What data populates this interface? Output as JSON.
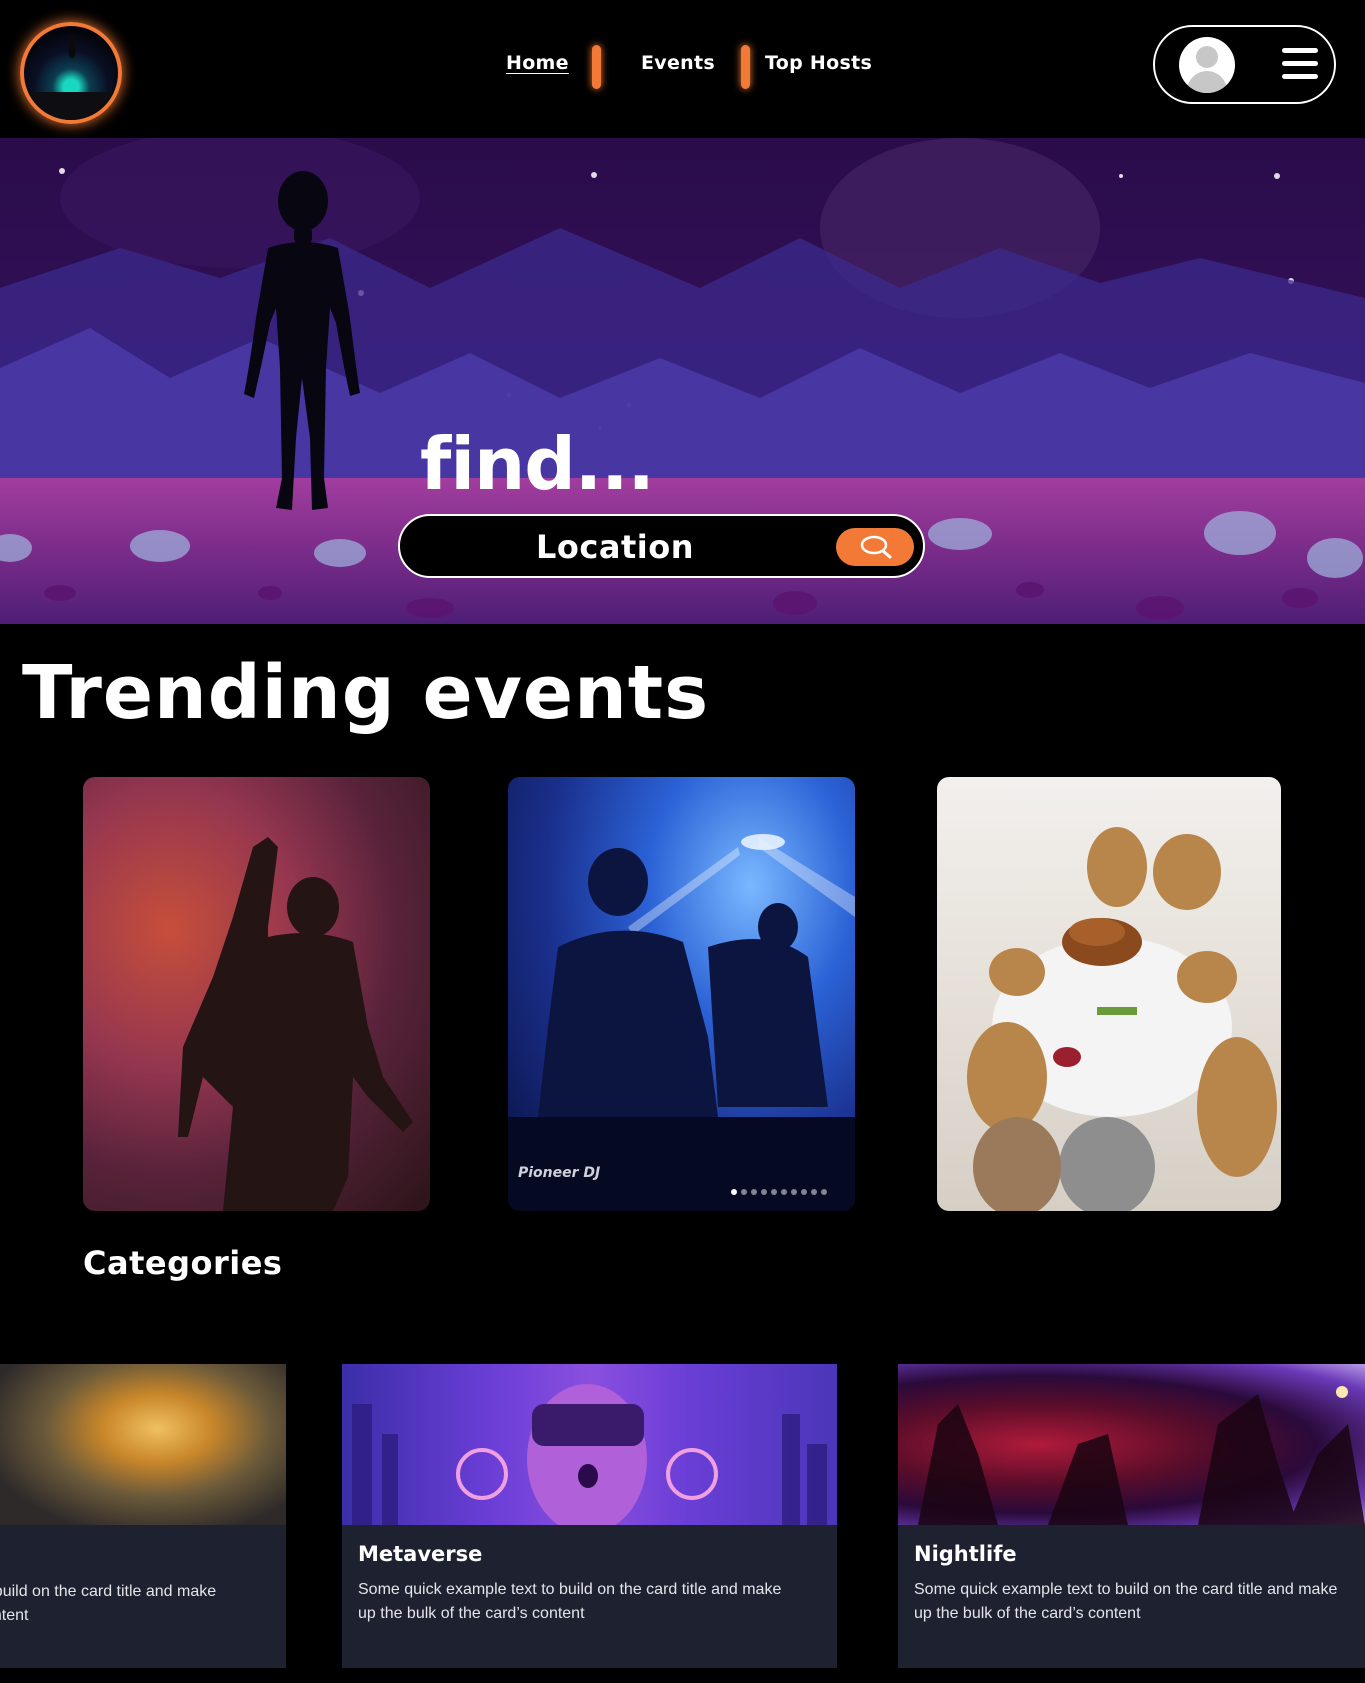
{
  "header": {
    "nav": [
      {
        "label": "Home",
        "active": true
      },
      {
        "label": "Events"
      },
      {
        "label": "Top Hosts"
      }
    ],
    "accent": "#f27a36"
  },
  "hero": {
    "heading": "find...",
    "search": {
      "value": "Location",
      "icon": "search-icon"
    }
  },
  "trending": {
    "title": "Trending events",
    "carousel_dot_count": 10,
    "carousel_active_index": 0
  },
  "categories": {
    "title": "Categories",
    "cards": [
      {
        "title": "",
        "text": "to build on the card title and make",
        "text2": "content"
      },
      {
        "title": "Metaverse",
        "text": "Some quick example text to build on the card title and make",
        "text2": "up the bulk of the card’s content"
      },
      {
        "title": "Nightlife",
        "text": "Some quick example text to build on the card title and make",
        "text2": "up the bulk of the card’s content"
      }
    ]
  },
  "colors": {
    "background": "#000000",
    "card": "#1e2230",
    "accent": "#f27a36"
  }
}
